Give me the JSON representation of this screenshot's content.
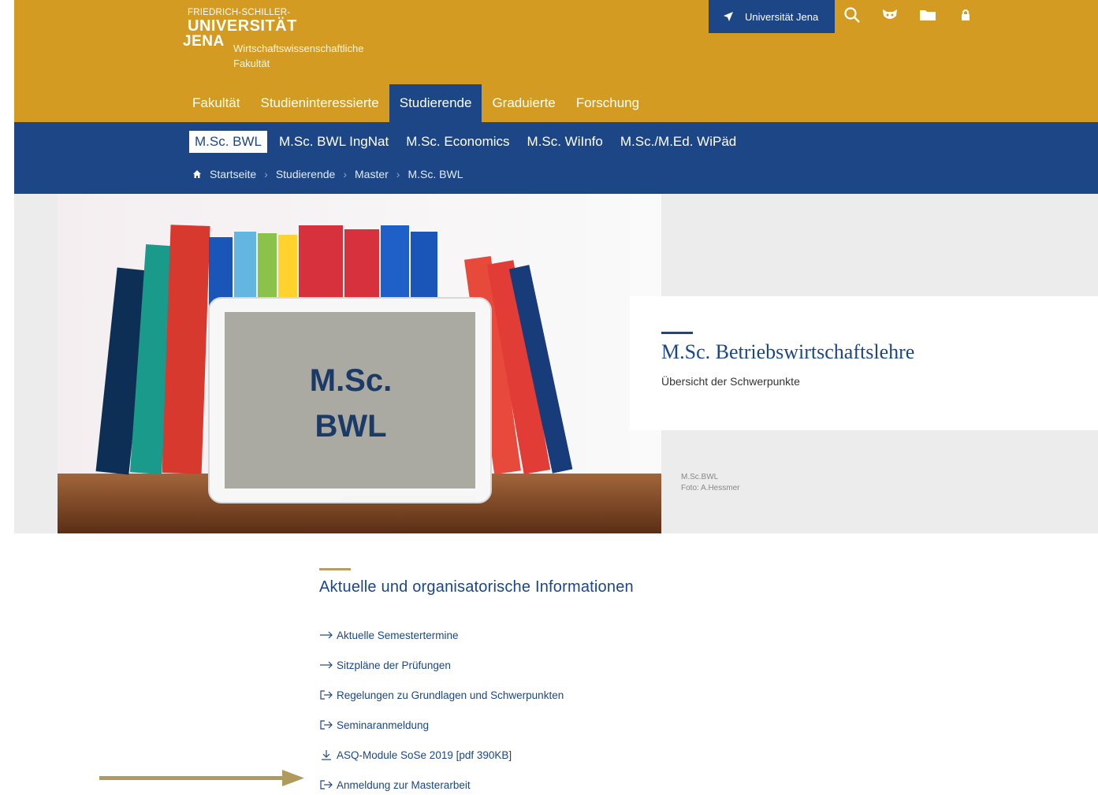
{
  "header": {
    "logo": {
      "line1": "FRIEDRICH-SCHILLER-",
      "line2": "UNIVERSITÄT",
      "line3": "JENA",
      "faculty_line1": "Wirtschaftswissenschaftliche",
      "faculty_line2": "Fakultät"
    },
    "uni_button": "Universität Jena",
    "tool_icons": [
      "search-icon",
      "cat-mascot-icon",
      "folder-icon",
      "lock-icon"
    ],
    "main_nav": [
      {
        "label": "Fakultät",
        "active": false
      },
      {
        "label": "Studieninteressierte",
        "active": false
      },
      {
        "label": "Studierende",
        "active": true
      },
      {
        "label": "Graduierte",
        "active": false
      },
      {
        "label": "Forschung",
        "active": false
      }
    ]
  },
  "subnav": {
    "tabs": [
      {
        "label": "M.Sc. BWL",
        "active": true
      },
      {
        "label": "M.Sc. BWL IngNat",
        "active": false
      },
      {
        "label": "M.Sc. Economics",
        "active": false
      },
      {
        "label": "M.Sc. WiInfo",
        "active": false
      },
      {
        "label": "M.Sc./M.Ed. WiPäd",
        "active": false
      }
    ],
    "breadcrumb": [
      "Startseite",
      "Studierende",
      "Master",
      "M.Sc. BWL"
    ]
  },
  "hero": {
    "tablet_text_line1": "M.Sc.",
    "tablet_text_line2": "BWL",
    "title": "M.Sc. Betriebswirtschaftslehre",
    "subtitle": "Übersicht der Schwerpunkte",
    "credit_line1": "M.Sc.BWL",
    "credit_line2": "Foto: A.Hessmer"
  },
  "content": {
    "heading": "Aktuelle und organisatorische Informationen",
    "links": [
      {
        "label": "Aktuelle Semestertermine",
        "icon": "arrow-right-icon"
      },
      {
        "label": "Sitzpläne der Prüfungen",
        "icon": "arrow-right-icon"
      },
      {
        "label": "Regelungen zu Grundlagen und Schwerpunkten",
        "icon": "external-link-icon"
      },
      {
        "label": "Seminaranmeldung",
        "icon": "external-link-icon"
      },
      {
        "label": "ASQ-Module SoSe 2019 [pdf 390KB]",
        "icon": "download-icon"
      },
      {
        "label": "Anmeldung zur Masterarbeit",
        "icon": "external-link-icon"
      }
    ]
  },
  "colors": {
    "gold": "#d39b21",
    "blue": "#1c4685",
    "pointer_arrow": "#b09a5c"
  }
}
